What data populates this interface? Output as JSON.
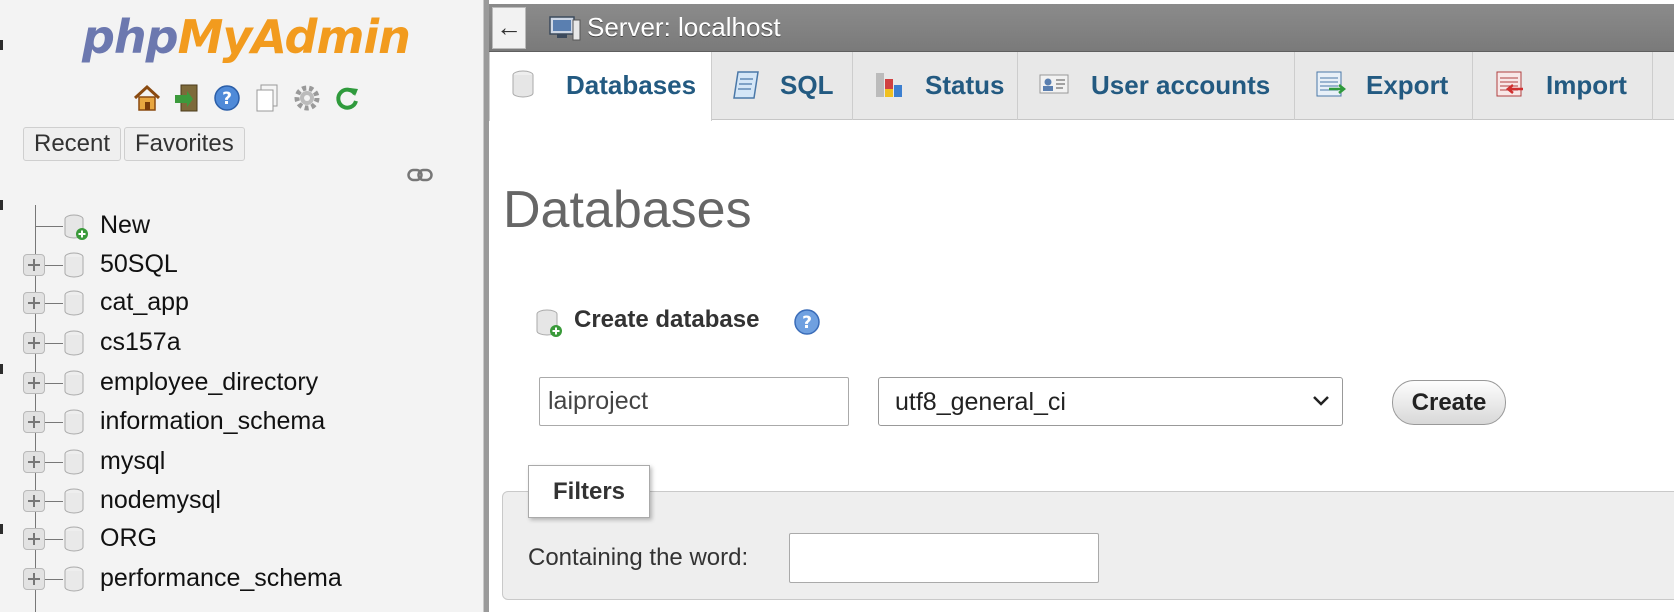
{
  "logo": {
    "part1": "php",
    "part2": "MyAdmin"
  },
  "nav_icons": [
    "home-icon",
    "logout-icon",
    "help-icon",
    "docs-icon",
    "settings-icon",
    "reload-icon"
  ],
  "nav_buttons": {
    "recent": "Recent",
    "favorites": "Favorites"
  },
  "tree": {
    "new_label": "New",
    "databases": [
      "50SQL",
      "cat_app",
      "cs157a",
      "employee_directory",
      "information_schema",
      "mysql",
      "nodemysql",
      "ORG",
      "performance_schema"
    ]
  },
  "topbar": {
    "back": "←",
    "server": "Server: localhost"
  },
  "tabs": [
    {
      "label": "Databases",
      "icon": "database-icon",
      "active": true
    },
    {
      "label": "SQL",
      "icon": "sql-icon"
    },
    {
      "label": "Status",
      "icon": "status-icon"
    },
    {
      "label": "User accounts",
      "icon": "user-accounts-icon"
    },
    {
      "label": "Export",
      "icon": "export-icon"
    },
    {
      "label": "Import",
      "icon": "import-icon"
    }
  ],
  "main": {
    "title": "Databases",
    "create_title": "Create database",
    "db_name_value": "laiproject",
    "collation_value": "utf8_general_ci",
    "create_button": "Create",
    "filters_title": "Filters",
    "filter_label": "Containing the word:",
    "filter_value": ""
  },
  "colors": {
    "logo_php": "#6c78af",
    "logo_myadmin": "#f29b1e",
    "tab_text": "#235a81",
    "topbar": "#808080"
  }
}
